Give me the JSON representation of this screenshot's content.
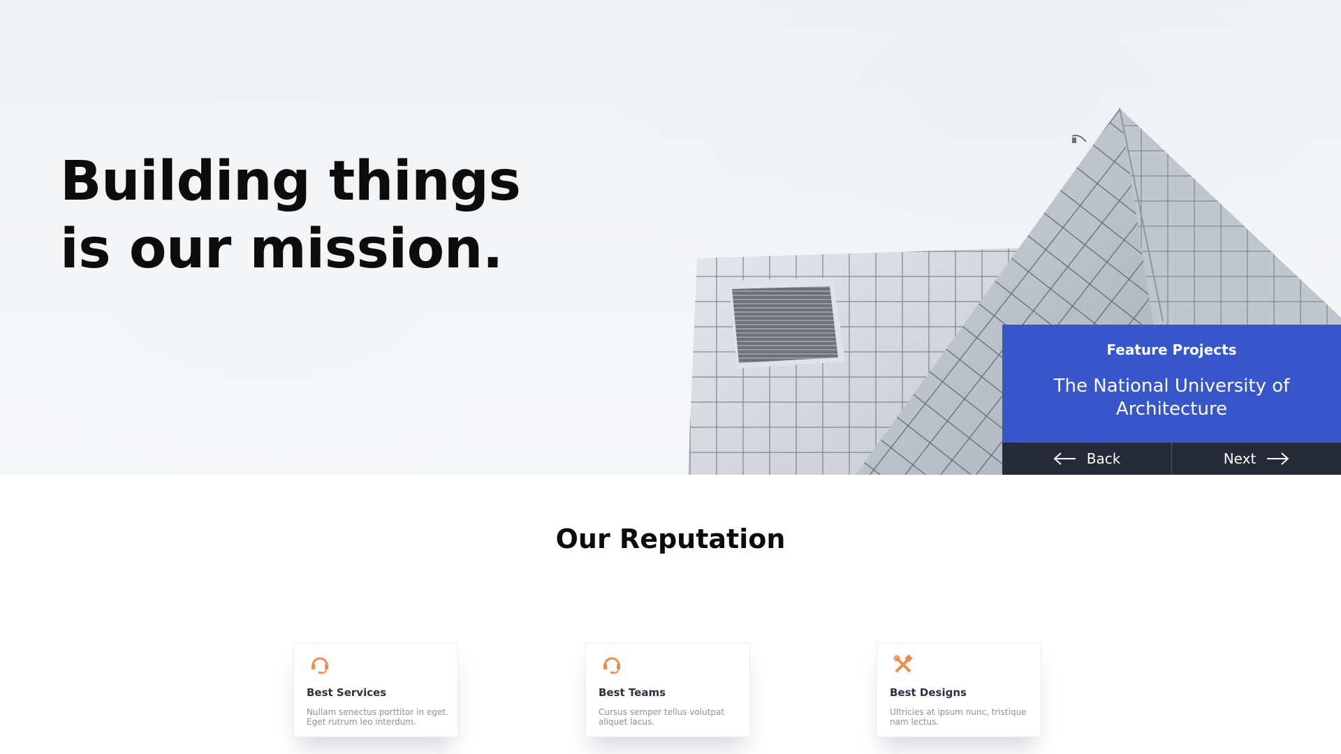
{
  "hero": {
    "title_line1": "Building things",
    "title_line2": "is our mission."
  },
  "feature": {
    "label": "Feature Projects",
    "project_name": "The National University of Architecture",
    "back_label": "Back",
    "next_label": "Next",
    "colors": {
      "panel": "#3656c9",
      "nav": "#262a36"
    }
  },
  "reputation": {
    "title": "Our Reputation",
    "cards": [
      {
        "icon": "headset-icon",
        "title": "Best Services",
        "description": "Nullam senectus porttitor in eget. Eget rutrum leo interdum."
      },
      {
        "icon": "headset-icon",
        "title": "Best Teams",
        "description": "Cursus semper tellus volutpat aliquet lacus."
      },
      {
        "icon": "tools-icon",
        "title": "Best Designs",
        "description": "Ultricies at ipsum nunc, tristique nam lectus."
      }
    ],
    "accent": "#f0894a"
  }
}
